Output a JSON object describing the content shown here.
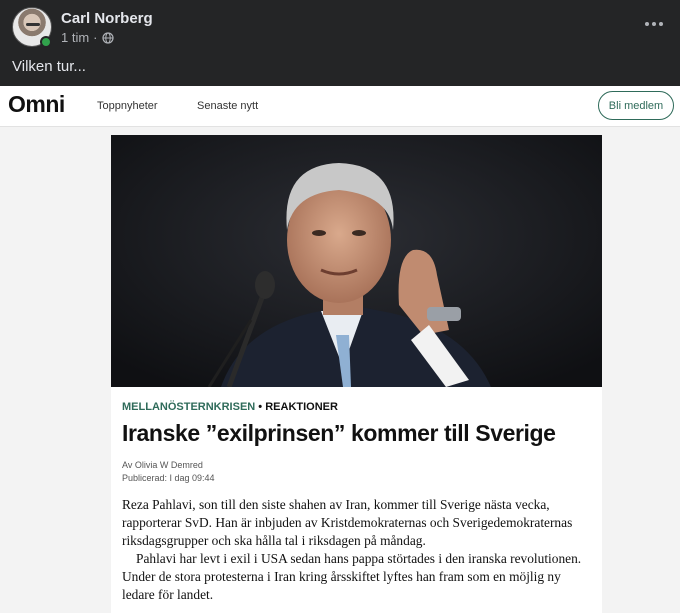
{
  "post": {
    "author": "Carl Norberg",
    "time": "1 tim",
    "separator": "·",
    "text": "Vilken tur..."
  },
  "omni": {
    "logo": "Omni",
    "nav": [
      "Toppnyheter",
      "Senaste nytt"
    ],
    "join_button": "Bli medlem"
  },
  "article": {
    "category_primary": "MELLANÖSTERNKRISEN",
    "category_separator": "•",
    "category_secondary": "REAKTIONER",
    "headline": "Iranske ”exilprinsen” kommer till Sverige",
    "byline": "Av Olivia W Demred",
    "published": "Publicerad: I dag 09:44",
    "paragraph1": "Reza Pahlavi, son till den siste shahen av Iran, kommer till Sverige nästa vecka, rapporterar SvD. Han är inbjuden av Kristdemokraternas och Sverigedemokraternas riksdagsgrupper och ska hålla tal i riksdagen på måndag.",
    "paragraph2": "Pahlavi har levt i exil i USA sedan hans pappa störtades i den iranska revolutionen. Under de stora protesterna i Iran kring årsskiftet lyftes han fram som en möjlig ny ledare för landet."
  },
  "colors": {
    "fb_background": "#242526",
    "omni_accent": "#2f6b5a",
    "online": "#31a24c"
  },
  "icons": [
    "globe-icon",
    "more-options-icon"
  ]
}
